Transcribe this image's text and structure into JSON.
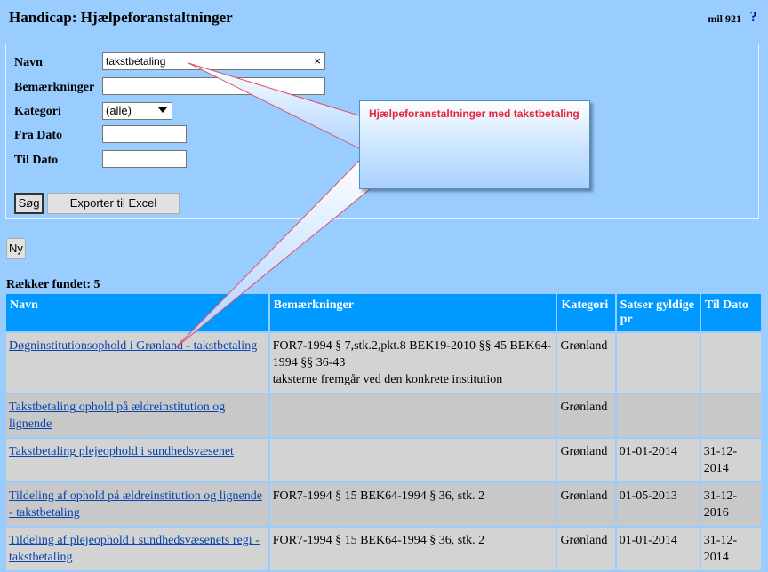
{
  "header": {
    "title": "Handicap: Hjælpeforanstaltninger",
    "app_code": "mil 921",
    "help": "?"
  },
  "search": {
    "fields": {
      "navn_label": "Navn",
      "navn_value": "takstbetaling",
      "navn_clear": "×",
      "bemaerkninger_label": "Bemærkninger",
      "kategori_label": "Kategori",
      "kategori_value": "(alle)",
      "fra_dato_label": "Fra Dato",
      "til_dato_label": "Til Dato"
    },
    "buttons": {
      "search": "Søg",
      "export": "Exporter til Excel"
    }
  },
  "new_button": "Ny",
  "rows_found": "Rækker fundet: 5",
  "table": {
    "headers": [
      "Navn",
      "Bemærkninger",
      "Kategori",
      "Satser gyldige pr",
      "Til Dato"
    ],
    "rows": [
      {
        "navn": "Døgninstitutionsophold i Grønland - takstbetaling",
        "bem1": "FOR7-1994 § 7,stk.2,pkt.8 BEK19-2010 §§ 45 BEK64-1994 §§ 36-43",
        "bem2": "taksterne fremgår ved den konkrete institution",
        "kategori": "Grønland",
        "satser": "",
        "til": ""
      },
      {
        "navn": "Takstbetaling ophold på ældreinstitution og lignende",
        "bem1": "",
        "bem2": "",
        "kategori": "Grønland",
        "satser": "",
        "til": ""
      },
      {
        "navn": "Takstbetaling plejeophold i sundhedsvæsenet",
        "bem1": "",
        "bem2": "",
        "kategori": "Grønland",
        "satser": "01-01-2014",
        "til": "31-12-2014"
      },
      {
        "navn": "Tildeling af ophold på ældreinstitution og lignende - takstbetaling",
        "bem1": "FOR7-1994 § 15 BEK64-1994 § 36, stk. 2",
        "bem2": "",
        "kategori": "Grønland",
        "satser": "01-05-2013",
        "til": "31-12-2016"
      },
      {
        "navn": "Tildeling af plejeophold i sundhedsvæsenets regi - takstbetaling",
        "bem1": "FOR7-1994 § 15 BEK64-1994 § 36, stk. 2",
        "bem2": "",
        "kategori": "Grønland",
        "satser": "01-01-2014",
        "til": "31-12-2014"
      }
    ]
  },
  "callout": {
    "text": "Hjælpeforanstaltninger med takstbetaling"
  },
  "colors": {
    "page_bg": "#99ccff",
    "table_header_bg": "#0099ff",
    "row_bg": "#d3d3d3",
    "link": "#0645ad",
    "callout_text": "#e8243a"
  }
}
